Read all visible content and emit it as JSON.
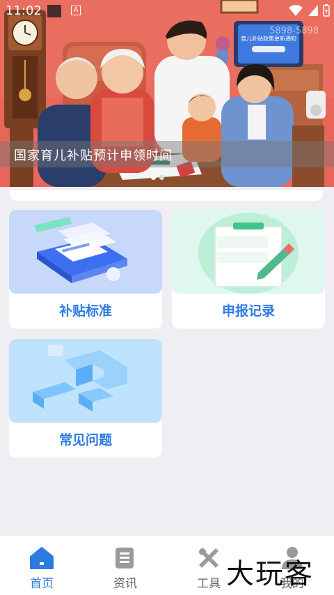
{
  "status_bar": {
    "time": "11:02",
    "a_badge": "A"
  },
  "banner": {
    "caption": "国家育儿补贴预计申领时间",
    "tv_text": "育儿补贴政策更新通知",
    "tv_number": "5898-5898",
    "slide_count": 2,
    "active_slide": 1
  },
  "cards": [
    {
      "label": "补贴标准",
      "icon": "documents-stack-illustration"
    },
    {
      "label": "申报记录",
      "icon": "clipboard-pencil-illustration"
    },
    {
      "label": "常见问题",
      "icon": "question-mark-illustration"
    }
  ],
  "tab_bar": {
    "active_index": 0,
    "tabs": [
      {
        "label": "首页",
        "icon": "home-icon"
      },
      {
        "label": "资讯",
        "icon": "news-icon"
      },
      {
        "label": "工具",
        "icon": "tools-icon"
      },
      {
        "label": "我的",
        "icon": "profile-icon"
      }
    ]
  },
  "watermark": "大玩客",
  "colors": {
    "accent": "#2d7be0",
    "banner_bg": "#e8685a",
    "page_bg": "#eeeef3"
  }
}
